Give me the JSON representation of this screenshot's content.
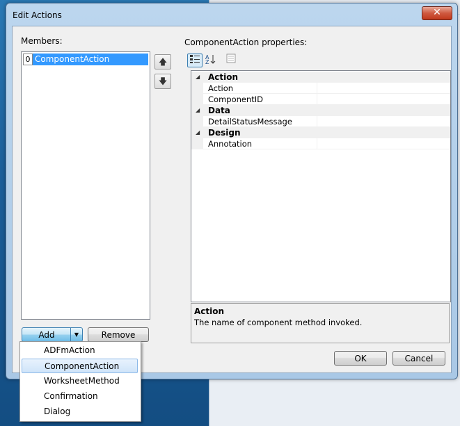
{
  "dialog": {
    "title": "Edit Actions",
    "close_label": "✕"
  },
  "members": {
    "label": "Members:",
    "items": [
      {
        "index": "0",
        "label": "ComponentAction"
      }
    ],
    "up_label": "🡅",
    "down_label": "🡇"
  },
  "properties": {
    "label": "ComponentAction properties:",
    "categories": [
      {
        "name": "Action",
        "props": [
          "Action",
          "ComponentID"
        ]
      },
      {
        "name": "Data",
        "props": [
          "DetailStatusMessage"
        ]
      },
      {
        "name": "Design",
        "props": [
          "Annotation"
        ]
      }
    ],
    "description": {
      "title": "Action",
      "text": "The name of component method invoked."
    }
  },
  "buttons": {
    "add": "Add",
    "remove": "Remove",
    "ok": "OK",
    "cancel": "Cancel"
  },
  "add_menu": {
    "items": [
      "ADFmAction",
      "ComponentAction",
      "WorksheetMethod",
      "Confirmation",
      "Dialog"
    ],
    "highlighted": "ComponentAction"
  },
  "colors": {
    "selection": "#3399ff",
    "titlebar": "#bcd6ee",
    "close": "#c0381c"
  }
}
